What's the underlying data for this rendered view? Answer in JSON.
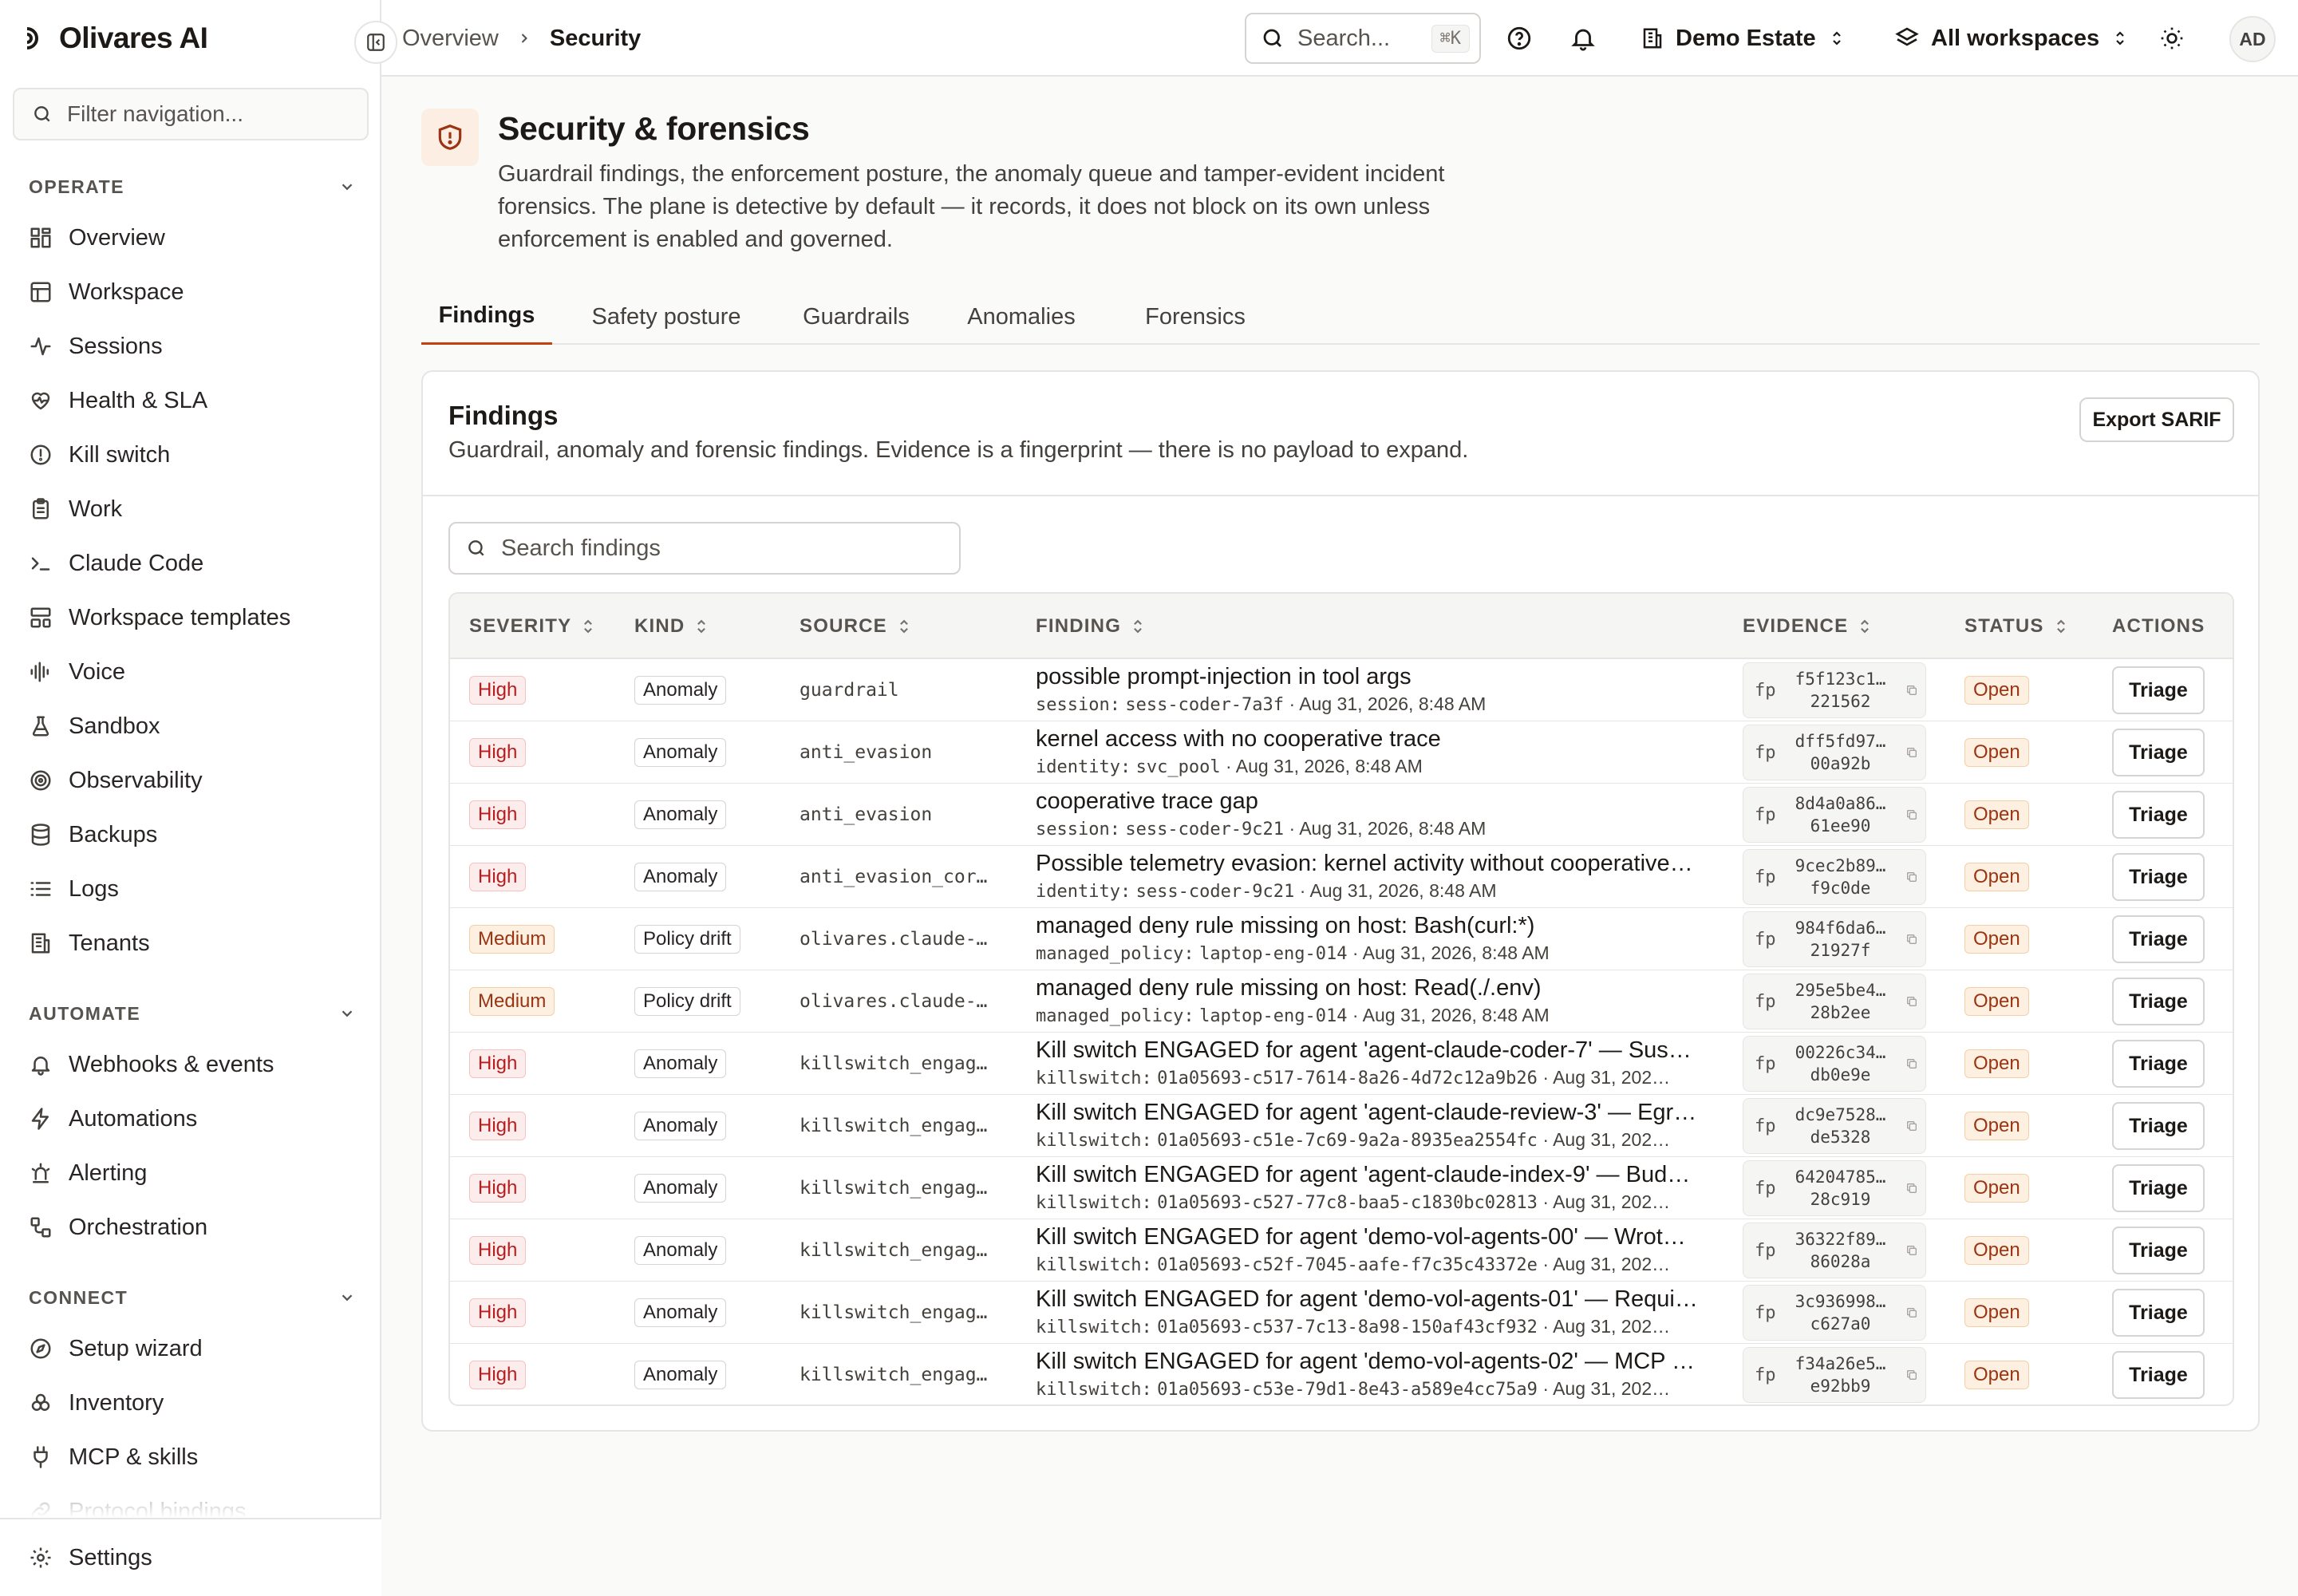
{
  "app": {
    "name": "Olivares AI"
  },
  "sidebar": {
    "filter_placeholder": "Filter navigation...",
    "sections": [
      {
        "label": "OPERATE",
        "items": [
          {
            "label": "Overview",
            "icon": "grid-icon"
          },
          {
            "label": "Workspace",
            "icon": "layout-icon"
          },
          {
            "label": "Sessions",
            "icon": "activity-icon"
          },
          {
            "label": "Health & SLA",
            "icon": "heart-pulse-icon"
          },
          {
            "label": "Kill switch",
            "icon": "alert-circle-icon"
          },
          {
            "label": "Work",
            "icon": "clipboard-icon"
          },
          {
            "label": "Claude Code",
            "icon": "terminal-icon"
          },
          {
            "label": "Workspace templates",
            "icon": "template-icon"
          },
          {
            "label": "Voice",
            "icon": "audio-lines-icon"
          },
          {
            "label": "Sandbox",
            "icon": "flask-icon"
          },
          {
            "label": "Observability",
            "icon": "target-icon"
          },
          {
            "label": "Backups",
            "icon": "database-icon"
          },
          {
            "label": "Logs",
            "icon": "list-icon"
          },
          {
            "label": "Tenants",
            "icon": "building-icon"
          }
        ]
      },
      {
        "label": "AUTOMATE",
        "items": [
          {
            "label": "Webhooks & events",
            "icon": "bell-icon"
          },
          {
            "label": "Automations",
            "icon": "zap-icon"
          },
          {
            "label": "Alerting",
            "icon": "siren-icon"
          },
          {
            "label": "Orchestration",
            "icon": "workflow-icon"
          }
        ]
      },
      {
        "label": "CONNECT",
        "items": [
          {
            "label": "Setup wizard",
            "icon": "compass-icon"
          },
          {
            "label": "Inventory",
            "icon": "boxes-icon"
          },
          {
            "label": "MCP & skills",
            "icon": "plug-icon"
          },
          {
            "label": "Protocol bindings",
            "icon": "link-icon"
          }
        ]
      }
    ],
    "footer": {
      "label": "Settings",
      "icon": "gear-icon"
    }
  },
  "topbar": {
    "breadcrumb": [
      "Overview",
      "Security"
    ],
    "search_label": "Search...",
    "search_shortcut": "⌘K",
    "estate": "Demo Estate",
    "workspace": "All workspaces",
    "avatar_initials": "AD"
  },
  "page": {
    "title": "Security & forensics",
    "description": "Guardrail findings, the enforcement posture, the anomaly queue and tamper-evident incident forensics. The plane is detective by default — it records, it does not block on its own unless enforcement is enabled and governed.",
    "tabs": [
      "Findings",
      "Safety posture",
      "Guardrails",
      "Anomalies",
      "Forensics"
    ],
    "active_tab": "Findings"
  },
  "findings": {
    "title": "Findings",
    "description": "Guardrail, anomaly and forensic findings. Evidence is a fingerprint — there is no payload to expand.",
    "export_label": "Export SARIF",
    "search_placeholder": "Search findings",
    "columns": [
      "SEVERITY",
      "KIND",
      "SOURCE",
      "FINDING",
      "EVIDENCE",
      "STATUS",
      "ACTIONS"
    ],
    "action_label": "Triage",
    "rows": [
      {
        "severity": "High",
        "kind": "Anomaly",
        "source": "guardrail",
        "title": "possible prompt-injection in tool args",
        "meta_key": "session:",
        "meta_val": "sess-coder-7a3f",
        "meta_time": "· Aug 31, 2026, 8:48 AM",
        "fp": "fp",
        "hash1": "f5f123c1…",
        "hash2": "221562",
        "status": "Open"
      },
      {
        "severity": "High",
        "kind": "Anomaly",
        "source": "anti_evasion",
        "title": "kernel access with no cooperative trace",
        "meta_key": "identity:",
        "meta_val": "svc_pool",
        "meta_time": "· Aug 31, 2026, 8:48 AM",
        "fp": "fp",
        "hash1": "dff5fd97…",
        "hash2": "00a92b",
        "status": "Open"
      },
      {
        "severity": "High",
        "kind": "Anomaly",
        "source": "anti_evasion",
        "title": "cooperative trace gap",
        "meta_key": "session:",
        "meta_val": "sess-coder-9c21",
        "meta_time": "· Aug 31, 2026, 8:48 AM",
        "fp": "fp",
        "hash1": "8d4a0a86…",
        "hash2": "61ee90",
        "status": "Open"
      },
      {
        "severity": "High",
        "kind": "Anomaly",
        "source": "anti_evasion_cor…",
        "title": "Possible telemetry evasion: kernel activity without cooperative…",
        "meta_key": "identity:",
        "meta_val": "sess-coder-9c21",
        "meta_time": "· Aug 31, 2026, 8:48 AM",
        "fp": "fp",
        "hash1": "9cec2b89…",
        "hash2": "f9c0de",
        "status": "Open"
      },
      {
        "severity": "Medium",
        "kind": "Policy drift",
        "source": "olivares.claude-…",
        "title": "managed deny rule missing on host: Bash(curl:*)",
        "meta_key": "managed_policy:",
        "meta_val": "laptop-eng-014",
        "meta_time": "· Aug 31, 2026, 8:48 AM",
        "fp": "fp",
        "hash1": "984f6da6…",
        "hash2": "21927f",
        "status": "Open"
      },
      {
        "severity": "Medium",
        "kind": "Policy drift",
        "source": "olivares.claude-…",
        "title": "managed deny rule missing on host: Read(./.env)",
        "meta_key": "managed_policy:",
        "meta_val": "laptop-eng-014",
        "meta_time": "· Aug 31, 2026, 8:48 AM",
        "fp": "fp",
        "hash1": "295e5be4…",
        "hash2": "28b2ee",
        "status": "Open"
      },
      {
        "severity": "High",
        "kind": "Anomaly",
        "source": "killswitch_engag…",
        "title": "Kill switch ENGAGED for agent 'agent-claude-coder-7' — Sus…",
        "meta_key": "killswitch:",
        "meta_val": "01a05693-c517-7614-8a26-4d72c12a9b26",
        "meta_time": "· Aug 31, 202…",
        "fp": "fp",
        "hash1": "00226c34…",
        "hash2": "db0e9e",
        "status": "Open"
      },
      {
        "severity": "High",
        "kind": "Anomaly",
        "source": "killswitch_engag…",
        "title": "Kill switch ENGAGED for agent 'agent-claude-review-3' — Egr…",
        "meta_key": "killswitch:",
        "meta_val": "01a05693-c51e-7c69-9a2a-8935ea2554fc",
        "meta_time": "· Aug 31, 202…",
        "fp": "fp",
        "hash1": "dc9e7528…",
        "hash2": "de5328",
        "status": "Open"
      },
      {
        "severity": "High",
        "kind": "Anomaly",
        "source": "killswitch_engag…",
        "title": "Kill switch ENGAGED for agent 'agent-claude-index-9' — Bud…",
        "meta_key": "killswitch:",
        "meta_val": "01a05693-c527-77c8-baa5-c1830bc02813",
        "meta_time": "· Aug 31, 202…",
        "fp": "fp",
        "hash1": "64204785…",
        "hash2": "28c919",
        "status": "Open"
      },
      {
        "severity": "High",
        "kind": "Anomaly",
        "source": "killswitch_engag…",
        "title": "Kill switch ENGAGED for agent 'demo-vol-agents-00' — Wrot…",
        "meta_key": "killswitch:",
        "meta_val": "01a05693-c52f-7045-aafe-f7c35c43372e",
        "meta_time": "· Aug 31, 202…",
        "fp": "fp",
        "hash1": "36322f89…",
        "hash2": "86028a",
        "status": "Open"
      },
      {
        "severity": "High",
        "kind": "Anomaly",
        "source": "killswitch_engag…",
        "title": "Kill switch ENGAGED for agent 'demo-vol-agents-01' — Requi…",
        "meta_key": "killswitch:",
        "meta_val": "01a05693-c537-7c13-8a98-150af43cf932",
        "meta_time": "· Aug 31, 202…",
        "fp": "fp",
        "hash1": "3c936998…",
        "hash2": "c627a0",
        "status": "Open"
      },
      {
        "severity": "High",
        "kind": "Anomaly",
        "source": "killswitch_engag…",
        "title": "Kill switch ENGAGED for agent 'demo-vol-agents-02' — MCP …",
        "meta_key": "killswitch:",
        "meta_val": "01a05693-c53e-79d1-8e43-a589e4cc75a9",
        "meta_time": "· Aug 31, 202…",
        "fp": "fp",
        "hash1": "f34a26e5…",
        "hash2": "e92bb9",
        "status": "Open"
      }
    ]
  }
}
